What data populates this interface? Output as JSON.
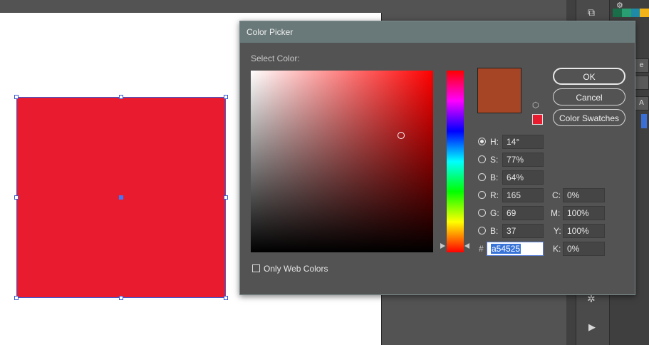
{
  "dialog": {
    "title": "Color Picker",
    "select_color_label": "Select Color:",
    "new_color": "#a54525",
    "previous_color": "#e81c2e",
    "buttons": {
      "ok": "OK",
      "cancel": "Cancel",
      "swatches": "Color Swatches"
    },
    "hsb": {
      "h_label": "H:",
      "h_value": "14°",
      "s_label": "S:",
      "s_value": "77%",
      "b_label": "B:",
      "b_value": "64%"
    },
    "rgb": {
      "r_label": "R:",
      "r_value": "165",
      "g_label": "G:",
      "g_value": "69",
      "b_label": "B:",
      "b_value": "37"
    },
    "hex": {
      "label": "#",
      "value": "a54525"
    },
    "cmyk": {
      "c_label": "C:",
      "c_value": "0%",
      "m_label": "M:",
      "m_value": "100%",
      "y_label": "Y:",
      "y_value": "100%",
      "k_label": "K:",
      "k_value": "0%"
    },
    "only_web_colors_label": "Only Web Colors",
    "selected_radio": "H"
  },
  "canvas": {
    "rect_fill": "#e81c2e"
  },
  "panel": {
    "side_labels": [
      "e",
      "A"
    ]
  },
  "icons": {
    "gamut": "cube-icon",
    "tools": [
      "arrange-icon",
      "gear-icon",
      "play-icon",
      "knob-icon"
    ]
  }
}
